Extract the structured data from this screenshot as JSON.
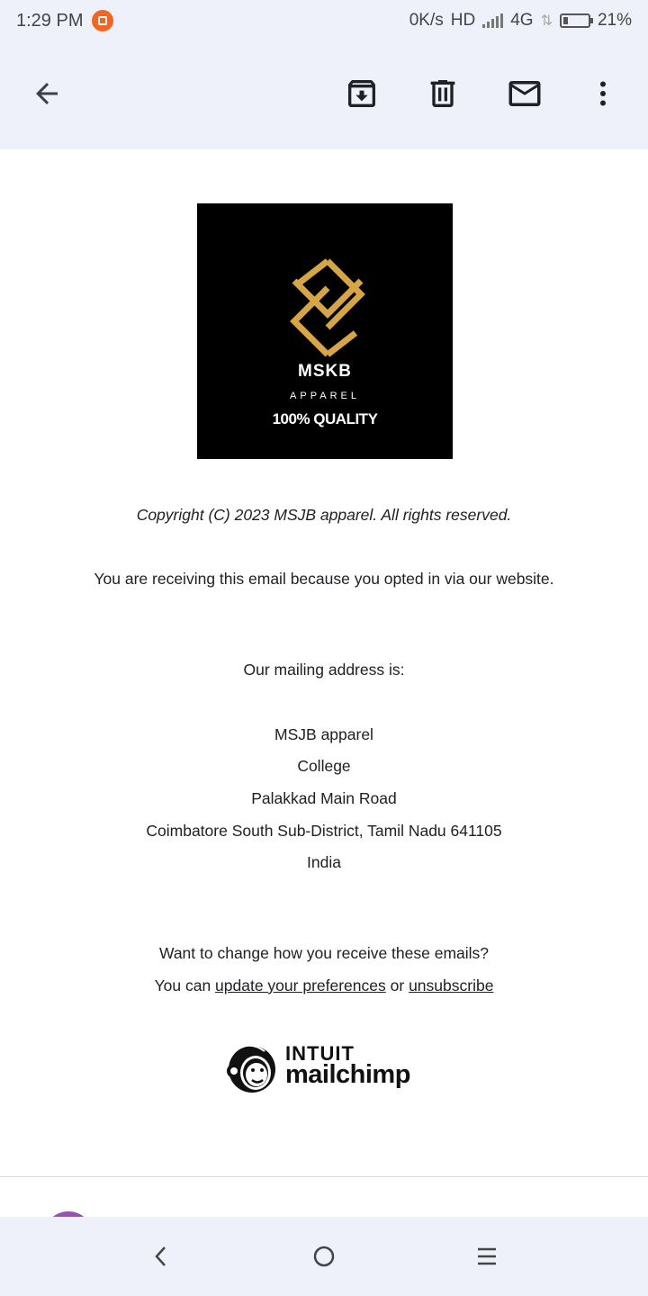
{
  "status_bar": {
    "time": "1:29 PM",
    "net_speed": "0K/s",
    "hd": "HD",
    "network": "4G",
    "battery": "21%",
    "battery_level": 0.21
  },
  "app_bar": {
    "icons": [
      "back-arrow-icon",
      "archive-icon",
      "delete-icon",
      "mark-unread-icon",
      "more-options-icon"
    ]
  },
  "email": {
    "logo": {
      "brand": "MSKB",
      "sub": "APPAREL",
      "tagline": "100% QUALITY",
      "accent_color": "#d6a545"
    },
    "copyright": "Copyright (C) 2023 MSJB apparel. All rights reserved.",
    "reason": "You are receiving this email because you opted in via our website.",
    "address_heading": "Our mailing address is:",
    "address_lines": [
      "MSJB apparel",
      "College",
      "Palakkad Main Road",
      "Coimbatore South Sub-District, Tamil Nadu 641105",
      "India"
    ],
    "change_prompt": "Want to change how you receive these emails?",
    "prefs_prefix": "You can ",
    "update_link": "update your preferences",
    "prefs_or": " or ",
    "unsubscribe_link": "unsubscribe",
    "footer_logo": {
      "line1": "INTUIT",
      "line2": "mailchimp"
    }
  },
  "nav_bar": {
    "icons": [
      "back-nav-icon",
      "home-nav-icon",
      "recents-nav-icon"
    ]
  }
}
